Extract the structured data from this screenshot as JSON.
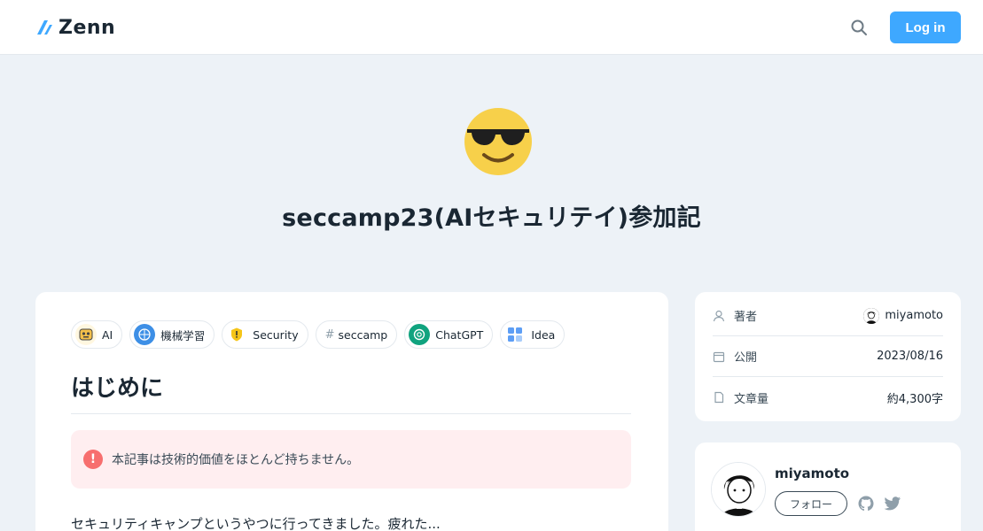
{
  "header": {
    "logo_text": "Zenn",
    "login_label": "Log in",
    "search_icon": "search-icon"
  },
  "article": {
    "emoji": "smiling-face-with-sunglasses",
    "title": "seccamp23(AIセキュリテイ)参加記",
    "tags": [
      {
        "label": "AI",
        "icon": "ai-tag-icon"
      },
      {
        "label": "機械学習",
        "icon": "brain-icon"
      },
      {
        "label": "Security",
        "icon": "shield-icon"
      },
      {
        "label": "seccamp",
        "icon": "hash-icon"
      },
      {
        "label": "ChatGPT",
        "icon": "chatgpt-icon"
      },
      {
        "label": "Idea",
        "icon": "idea-icon"
      }
    ],
    "heading": "はじめに",
    "alert_text": "本記事は技術的価値をほとんど持ちません。",
    "body_first_line": "セキュリティキャンプというやつに行ってきました。疲れた..."
  },
  "meta": {
    "author_label": "著者",
    "author_name": "miyamoto",
    "published_label": "公開",
    "published_date": "2023/08/16",
    "length_label": "文章量",
    "length_value": "約4,300字"
  },
  "author_card": {
    "name": "miyamoto",
    "follow_label": "フォロー"
  },
  "colors": {
    "accent": "#3ea8ff",
    "page_bg": "#edf2f7",
    "alert_bg": "#ffeef0",
    "alert_icon": "#f76e6e"
  }
}
